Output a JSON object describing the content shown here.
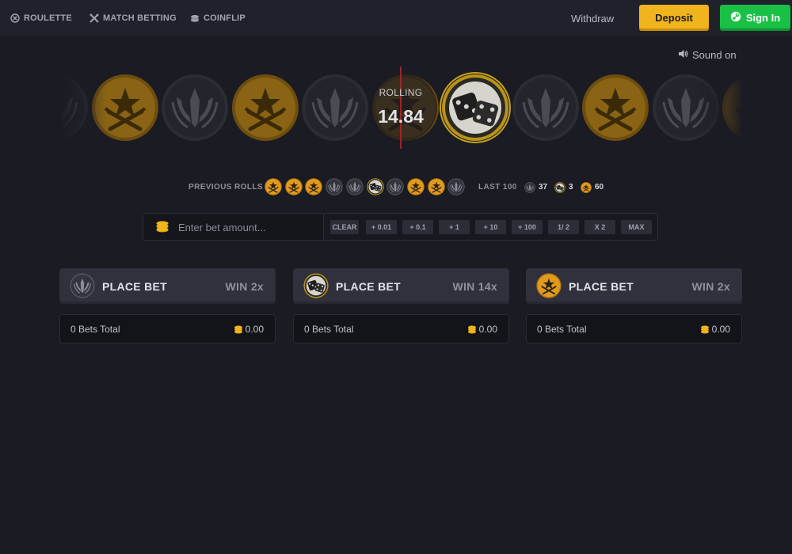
{
  "nav": {
    "items": [
      {
        "label": "ROULETTE",
        "icon": "roulette-icon"
      },
      {
        "label": "MATCH BETTING",
        "icon": "crossed-swords-icon"
      },
      {
        "label": "COINFLIP",
        "icon": "coin-stack-icon"
      }
    ],
    "withdraw_label": "Withdraw",
    "deposit_label": "Deposit",
    "signin_label": "Sign In",
    "signin_icon": "steam-icon"
  },
  "sound": {
    "label": "Sound on",
    "icon": "speaker-icon"
  },
  "roulette": {
    "status_label": "ROLLING",
    "status_value": "14.84",
    "strip": [
      "ct",
      "t",
      "ct",
      "t",
      "ct",
      "t",
      "dice",
      "ct",
      "t",
      "ct",
      "t"
    ]
  },
  "history": {
    "label": "PREVIOUS ROLLS",
    "rolls": [
      "t",
      "t",
      "t",
      "ct",
      "ct",
      "dice",
      "ct",
      "t",
      "t",
      "ct"
    ],
    "last_label": "LAST 100",
    "stats": [
      {
        "side": "ct",
        "count": "37"
      },
      {
        "side": "dice",
        "count": "3"
      },
      {
        "side": "t",
        "count": "60"
      }
    ]
  },
  "bet": {
    "placeholder": "Enter bet amount...",
    "value": "",
    "buttons": [
      "CLEAR",
      "+ 0.01",
      "+ 0.1",
      "+ 1",
      "+ 10",
      "+ 100",
      "1/ 2",
      "X 2",
      "MAX"
    ]
  },
  "panels": [
    {
      "side": "ct",
      "title": "PLACE BET",
      "win": "WIN 2x",
      "total": "0 Bets Total",
      "amount": "0.00"
    },
    {
      "side": "dice",
      "title": "PLACE BET",
      "win": "WIN 14x",
      "total": "0 Bets Total",
      "amount": "0.00"
    },
    {
      "side": "t",
      "title": "PLACE BET",
      "win": "WIN 2x",
      "total": "0 Bets Total",
      "amount": "0.00"
    }
  ],
  "colors": {
    "background": "#1a1b23",
    "deposit": "#f0b51c",
    "signin": "#1ac046",
    "t_gold": "#e09a1e",
    "ct_gray": "#3a3b44"
  }
}
